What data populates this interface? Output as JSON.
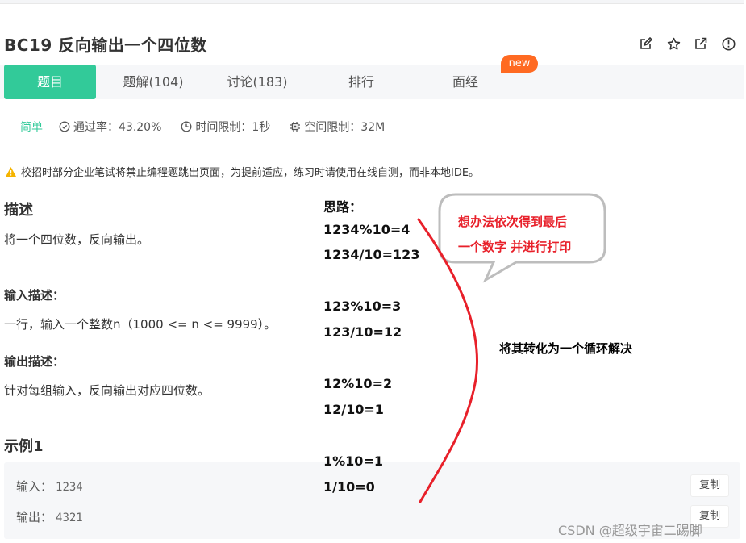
{
  "problem": {
    "title": "BC19  反向输出一个四位数"
  },
  "header_icons": [
    "edit-icon",
    "star-icon",
    "share-icon",
    "info-icon"
  ],
  "tabs": [
    {
      "label": "题目",
      "active": true
    },
    {
      "label": "题解(104)"
    },
    {
      "label": "讨论(183)"
    },
    {
      "label": "排行"
    },
    {
      "label": "面经"
    }
  ],
  "badge": "new",
  "meta": {
    "difficulty": "简单",
    "pass_rate": "通过率：43.20%",
    "time_limit": "时间限制：1秒",
    "space_limit": "空间限制：32M"
  },
  "warning": "校招时部分企业笔试将禁止编程题跳出页面，为提前适应，练习时请使用在线自测，而非本地IDE。",
  "description": {
    "heading": "描述",
    "text": "将一个四位数，反向输出。",
    "input_heading": "输入描述：",
    "input_text": "一行，输入一个整数n（1000 <= n <= 9999）。",
    "output_heading": "输出描述：",
    "output_text": "针对每组输入，反向输出对应四位数。"
  },
  "example": {
    "heading": "示例1",
    "input_label": "输入：",
    "input_value": "1234",
    "output_label": "输出：",
    "output_value": "4321",
    "copy_label": "复制"
  },
  "notes": {
    "title": "思路：",
    "lines": [
      "1234%10=4",
      "1234/10=123",
      "123%10=3",
      "123/10=12",
      "12%10=2",
      "12/10=1",
      "1%10=1",
      "1/10=0"
    ],
    "callout_line1": "想办法依次得到最后",
    "callout_line2": "一个数字 并进行打印",
    "loop_text": "将其转化为一个循环解决"
  },
  "watermark": "CSDN @超级宇宙二踢脚",
  "colors": {
    "accent": "#32ca99",
    "badge": "#ff6a22",
    "annotation": "#e8202a",
    "warning": "#f5b400"
  }
}
